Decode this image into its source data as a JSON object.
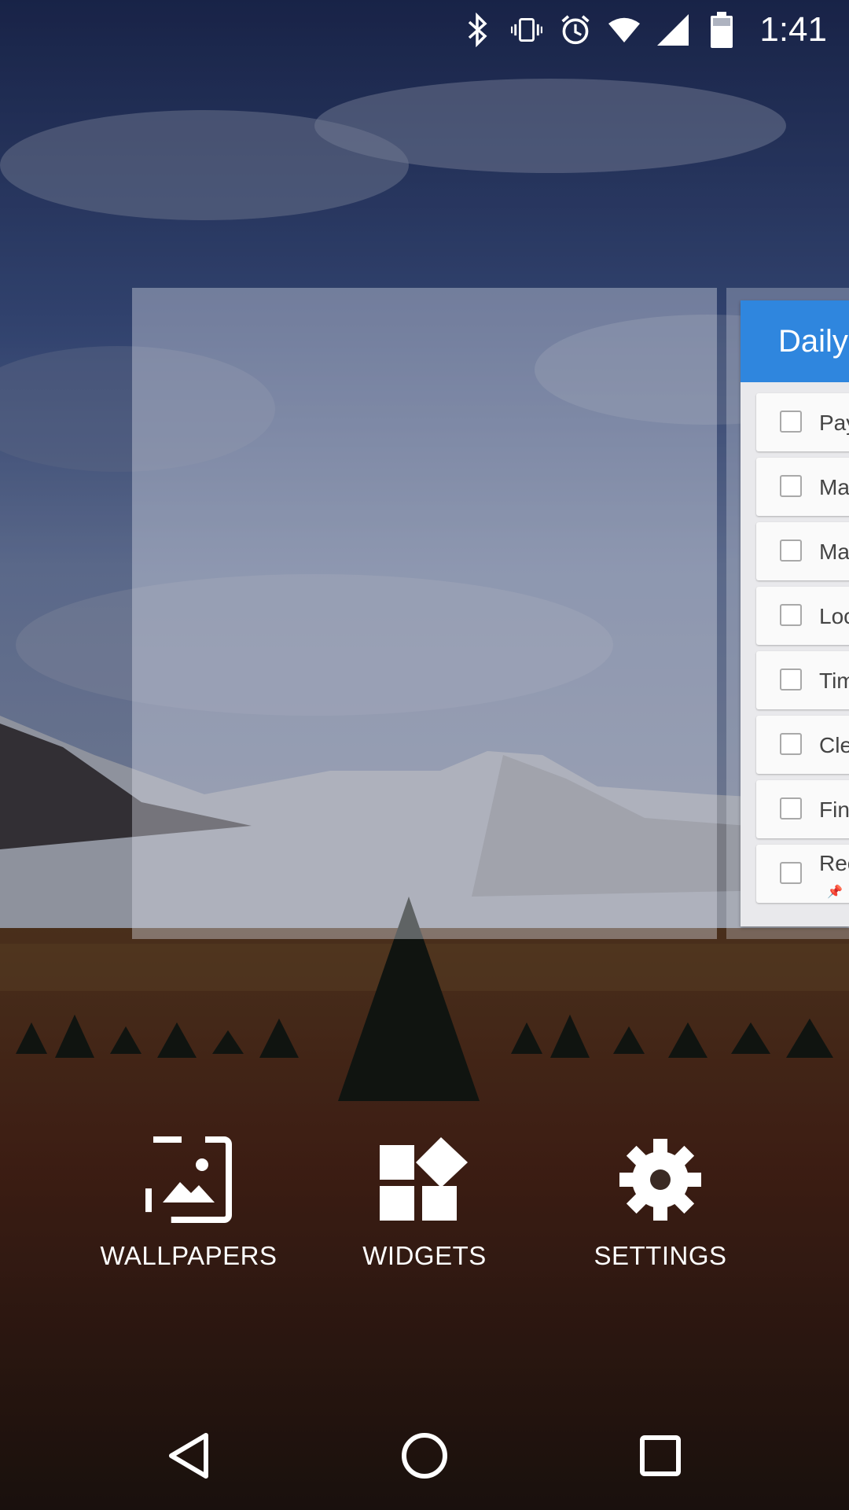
{
  "status_bar": {
    "time": "1:41",
    "icons": [
      "bluetooth-icon",
      "vibrate-icon",
      "alarm-icon",
      "wifi-icon",
      "signal-icon",
      "battery-icon"
    ]
  },
  "widget": {
    "title": "Daily",
    "tasks": [
      {
        "label": "Pay"
      },
      {
        "label": "Ma"
      },
      {
        "label": "Ma"
      },
      {
        "label": "Loc"
      },
      {
        "label": "Tim"
      },
      {
        "label": "Cle"
      },
      {
        "label": "Fin"
      },
      {
        "label": "Rec"
      }
    ]
  },
  "options": {
    "wallpapers": "WALLPAPERS",
    "widgets": "WIDGETS",
    "settings": "SETTINGS"
  },
  "nav_bar": {
    "icons": [
      "back-icon",
      "home-icon",
      "recents-icon"
    ]
  },
  "colors": {
    "widget_header": "#2f86de",
    "accent_text": "#ffffff"
  }
}
